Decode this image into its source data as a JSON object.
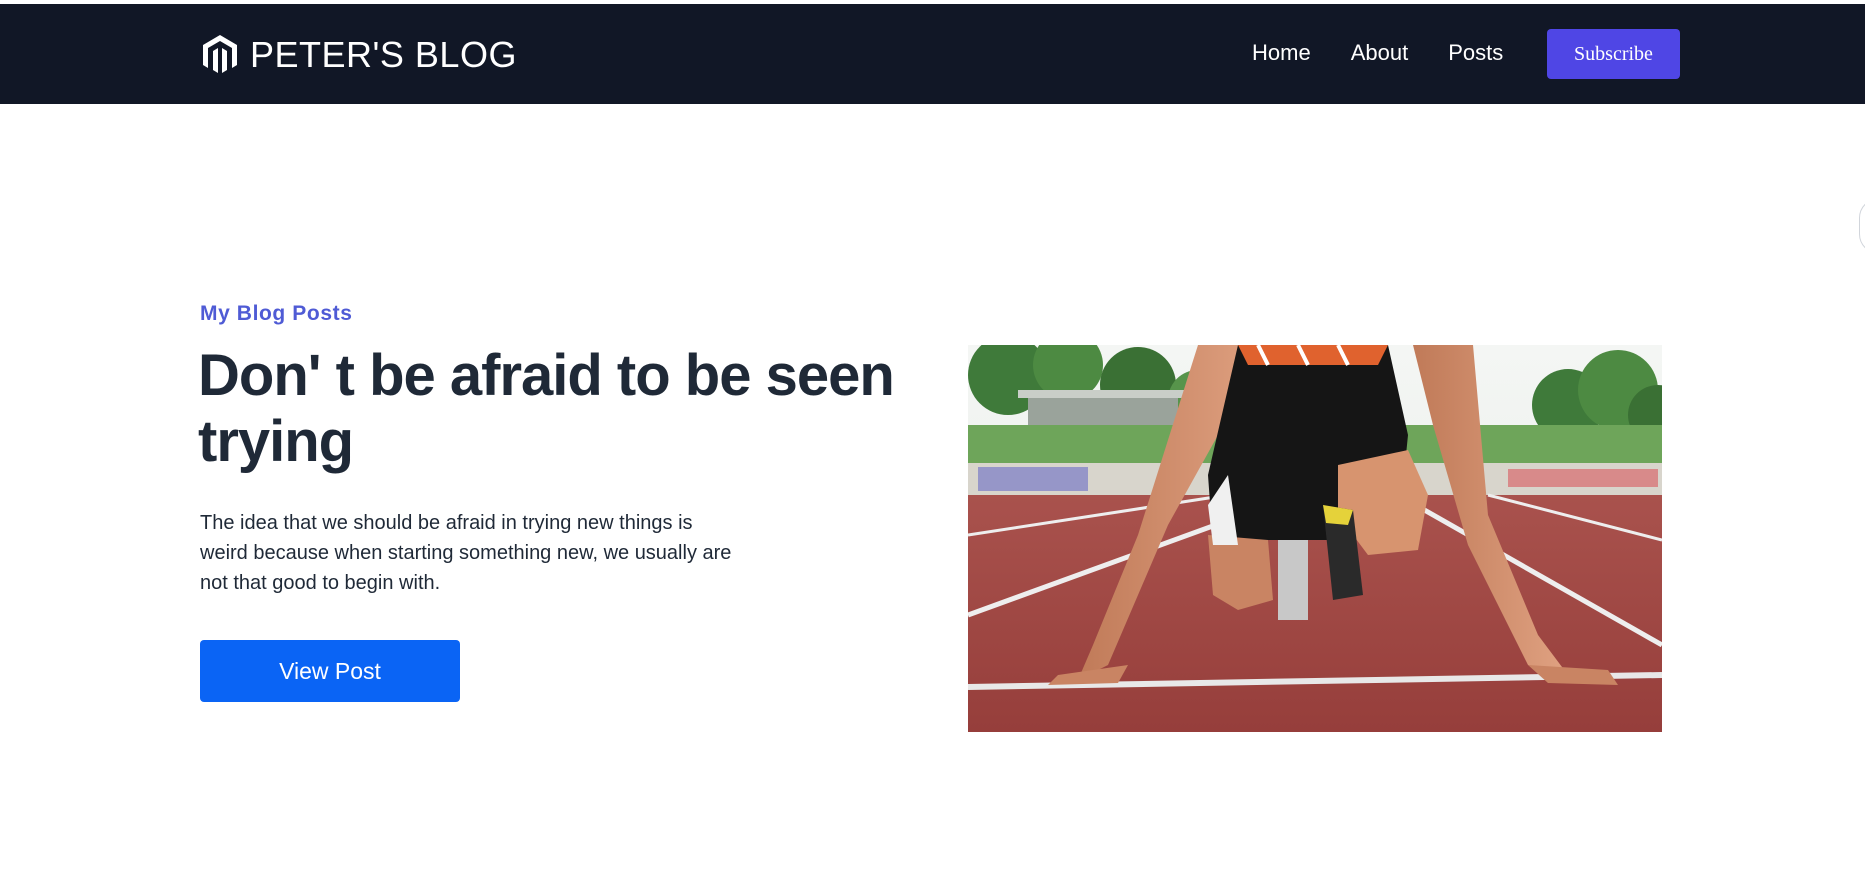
{
  "navbar": {
    "brand": "PETER'S BLOG",
    "links": [
      {
        "label": "Home"
      },
      {
        "label": "About"
      },
      {
        "label": "Posts"
      }
    ],
    "subscribe_label": "Subscribe"
  },
  "hero": {
    "eyebrow": "My Blog Posts",
    "headline": "Don' t be afraid to be seen trying",
    "excerpt": "The idea that we should be afraid in trying new things is weird because when starting something new, we usually are not that good to begin with.",
    "cta_label": "View Post",
    "image_icon": "sprinter-photo"
  },
  "colors": {
    "navbar_bg": "#111726",
    "accent": "#4f46e5",
    "eyebrow": "#4f5bd5",
    "cta": "#0a64f5",
    "text": "#1f2937"
  }
}
